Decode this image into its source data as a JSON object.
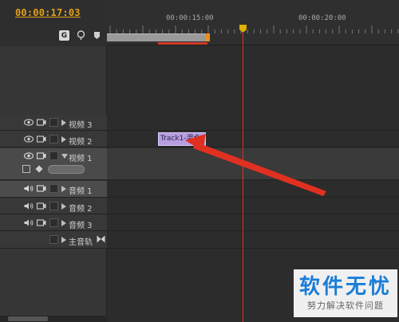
{
  "header": {
    "timecode": "00:00:17:03"
  },
  "ruler": {
    "labels": [
      "00:00:15:00",
      "00:00:20:00"
    ]
  },
  "tracks": [
    {
      "id": "v3",
      "name": "视频 3",
      "kind": "video",
      "expanded": false
    },
    {
      "id": "v2",
      "name": "视频 2",
      "kind": "video",
      "expanded": false
    },
    {
      "id": "v1",
      "name": "视频 1",
      "kind": "video",
      "expanded": true
    },
    {
      "id": "a1",
      "name": "音频 1",
      "kind": "audio",
      "expanded": false,
      "selected": true
    },
    {
      "id": "a2",
      "name": "音频 2",
      "kind": "audio",
      "expanded": false
    },
    {
      "id": "a3",
      "name": "音频 3",
      "kind": "audio",
      "expanded": false
    },
    {
      "id": "master",
      "name": "主音轨",
      "kind": "master",
      "expanded": false
    }
  ],
  "clip": {
    "label": "Track1-混合1",
    "track": "视频 2"
  },
  "icons": {
    "snap": "snap-icon",
    "marker_set": "set-encore-marker-icon",
    "marker": "marker-icon",
    "eye": "eye-icon",
    "camera": "camera-icon",
    "speaker": "speaker-icon"
  },
  "colors": {
    "timecode": "#e0a01a",
    "playhead": "#e03020",
    "clip": "#b79ee0",
    "work_area_end": "#e8901c",
    "render_bar": "#d03a2a",
    "annotation_arrow": "#e03020"
  },
  "watermark": {
    "title": "软件无忧",
    "subtitle": "努力解决软件问题"
  }
}
